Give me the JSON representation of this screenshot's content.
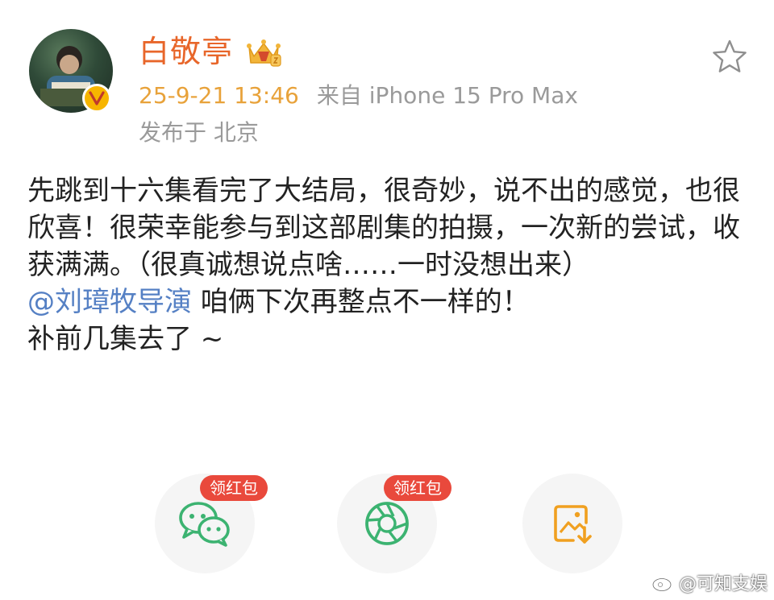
{
  "header": {
    "username": "白敬亭",
    "timestamp": "25-9-21 13:46",
    "source": "来自 iPhone 15 Pro Max",
    "location": "发布于 北京"
  },
  "post": {
    "paragraph_1": "先跳到十六集看完了大结局，很奇妙，说不出的感觉，也很欣喜！很荣幸能参与到这部剧集的拍摄，一次新的尝试，收获满满。（很真诚想说点啥……一时没想出来）",
    "mention": "@刘璋牧导演",
    "mention_suffix": " 咱俩下次再整点不一样的！",
    "paragraph_3": "补前几集去了 ~"
  },
  "share": {
    "wechat_tag": "领红包",
    "moments_tag": "领红包"
  },
  "watermark": {
    "text": "@可知支娱"
  },
  "colors": {
    "username": "#e8662a",
    "timestamp": "#e8a23a",
    "meta": "#9a9a9a",
    "mention": "#5580c4",
    "redpacket": "#e9493c",
    "wechat_green": "#3cb371",
    "save_orange": "#f0a020",
    "verified": "#f7b500"
  },
  "icons": {
    "avatar": "avatar",
    "verified": "verified-v-icon",
    "member": "crown-member-icon",
    "favorite": "star-icon",
    "wechat": "wechat-icon",
    "moments": "moments-icon",
    "save": "save-image-icon",
    "weibo": "weibo-logo-icon"
  }
}
